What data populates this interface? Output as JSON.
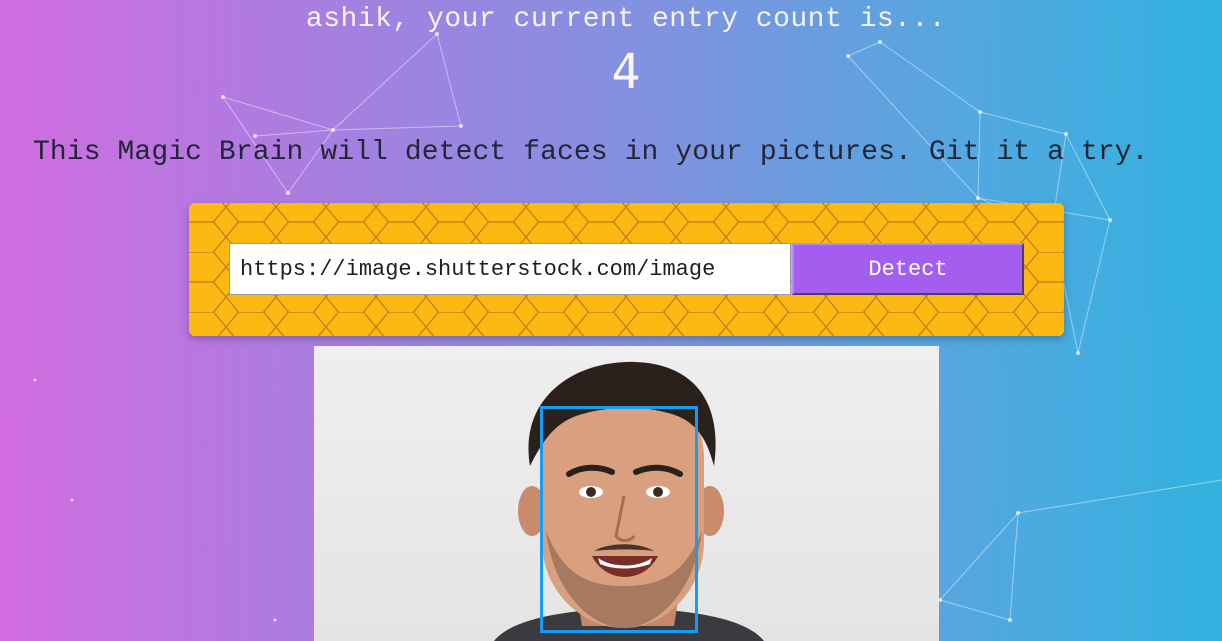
{
  "user": {
    "greeting": "ashik, your current entry count is...",
    "entry_count": "4"
  },
  "tagline": "This Magic Brain will detect faces in your pictures. Git it a try.",
  "form": {
    "url_value": "https://image.shutterstock.com/image",
    "detect_label": "Detect"
  },
  "photo": {
    "subject": "smiling-man-portrait",
    "face_box_color": "#149df2"
  },
  "colors": {
    "panel": "#fdb812",
    "button": "#a35ef0",
    "gradient_left": "#d26ce0",
    "gradient_right": "#30b2df"
  }
}
